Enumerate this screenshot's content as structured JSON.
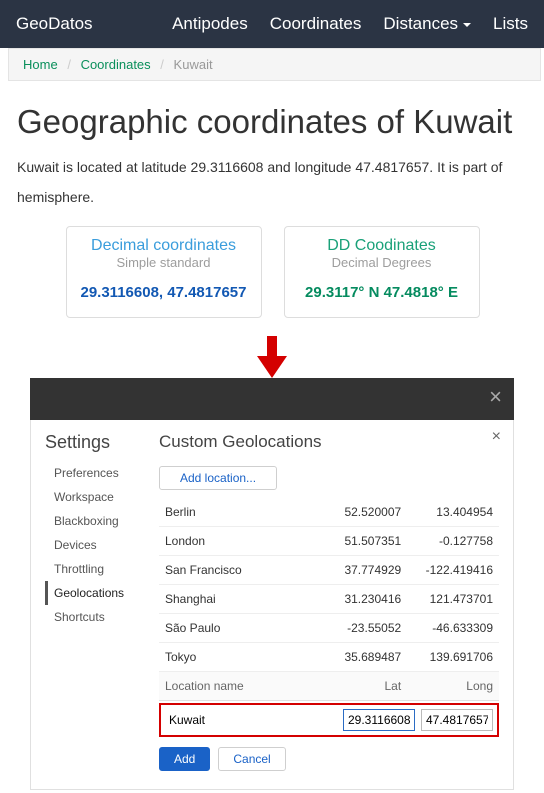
{
  "nav": {
    "brand": "GeoDatos",
    "items": [
      "Antipodes",
      "Coordinates",
      "Distances",
      "Lists"
    ]
  },
  "breadcrumb": {
    "home": "Home",
    "coordinates": "Coordinates",
    "current": "Kuwait"
  },
  "article": {
    "h1": "Geographic coordinates of Kuwait",
    "line1": "Kuwait is located at latitude 29.3116608 and longitude 47.4817657. It is part of",
    "line2": "hemisphere."
  },
  "boxes": {
    "dec": {
      "title": "Decimal coordinates",
      "sub": "Simple standard",
      "val": "29.3116608, 47.4817657"
    },
    "dd": {
      "title": "DD Coodinates",
      "sub": "Decimal Degrees",
      "val": "29.3117° N 47.4818° E"
    }
  },
  "settings": {
    "title": "Settings",
    "items": [
      "Preferences",
      "Workspace",
      "Blackboxing",
      "Devices",
      "Throttling",
      "Geolocations",
      "Shortcuts"
    ],
    "activeIndex": 5,
    "panelTitle": "Custom Geolocations",
    "addLabel": "Add location...",
    "headers": {
      "name": "Location name",
      "lat": "Lat",
      "lon": "Long"
    },
    "rows": [
      {
        "name": "Berlin",
        "lat": "52.520007",
        "lon": "13.404954"
      },
      {
        "name": "London",
        "lat": "51.507351",
        "lon": "-0.127758"
      },
      {
        "name": "San Francisco",
        "lat": "37.774929",
        "lon": "-122.419416"
      },
      {
        "name": "Shanghai",
        "lat": "31.230416",
        "lon": "121.473701"
      },
      {
        "name": "São Paulo",
        "lat": "-23.55052",
        "lon": "-46.633309"
      },
      {
        "name": "Tokyo",
        "lat": "35.689487",
        "lon": "139.691706"
      }
    ],
    "newRow": {
      "name": "Kuwait",
      "lat": "29.3116608",
      "lon": "47.4817657"
    },
    "buttons": {
      "add": "Add",
      "cancel": "Cancel"
    }
  }
}
